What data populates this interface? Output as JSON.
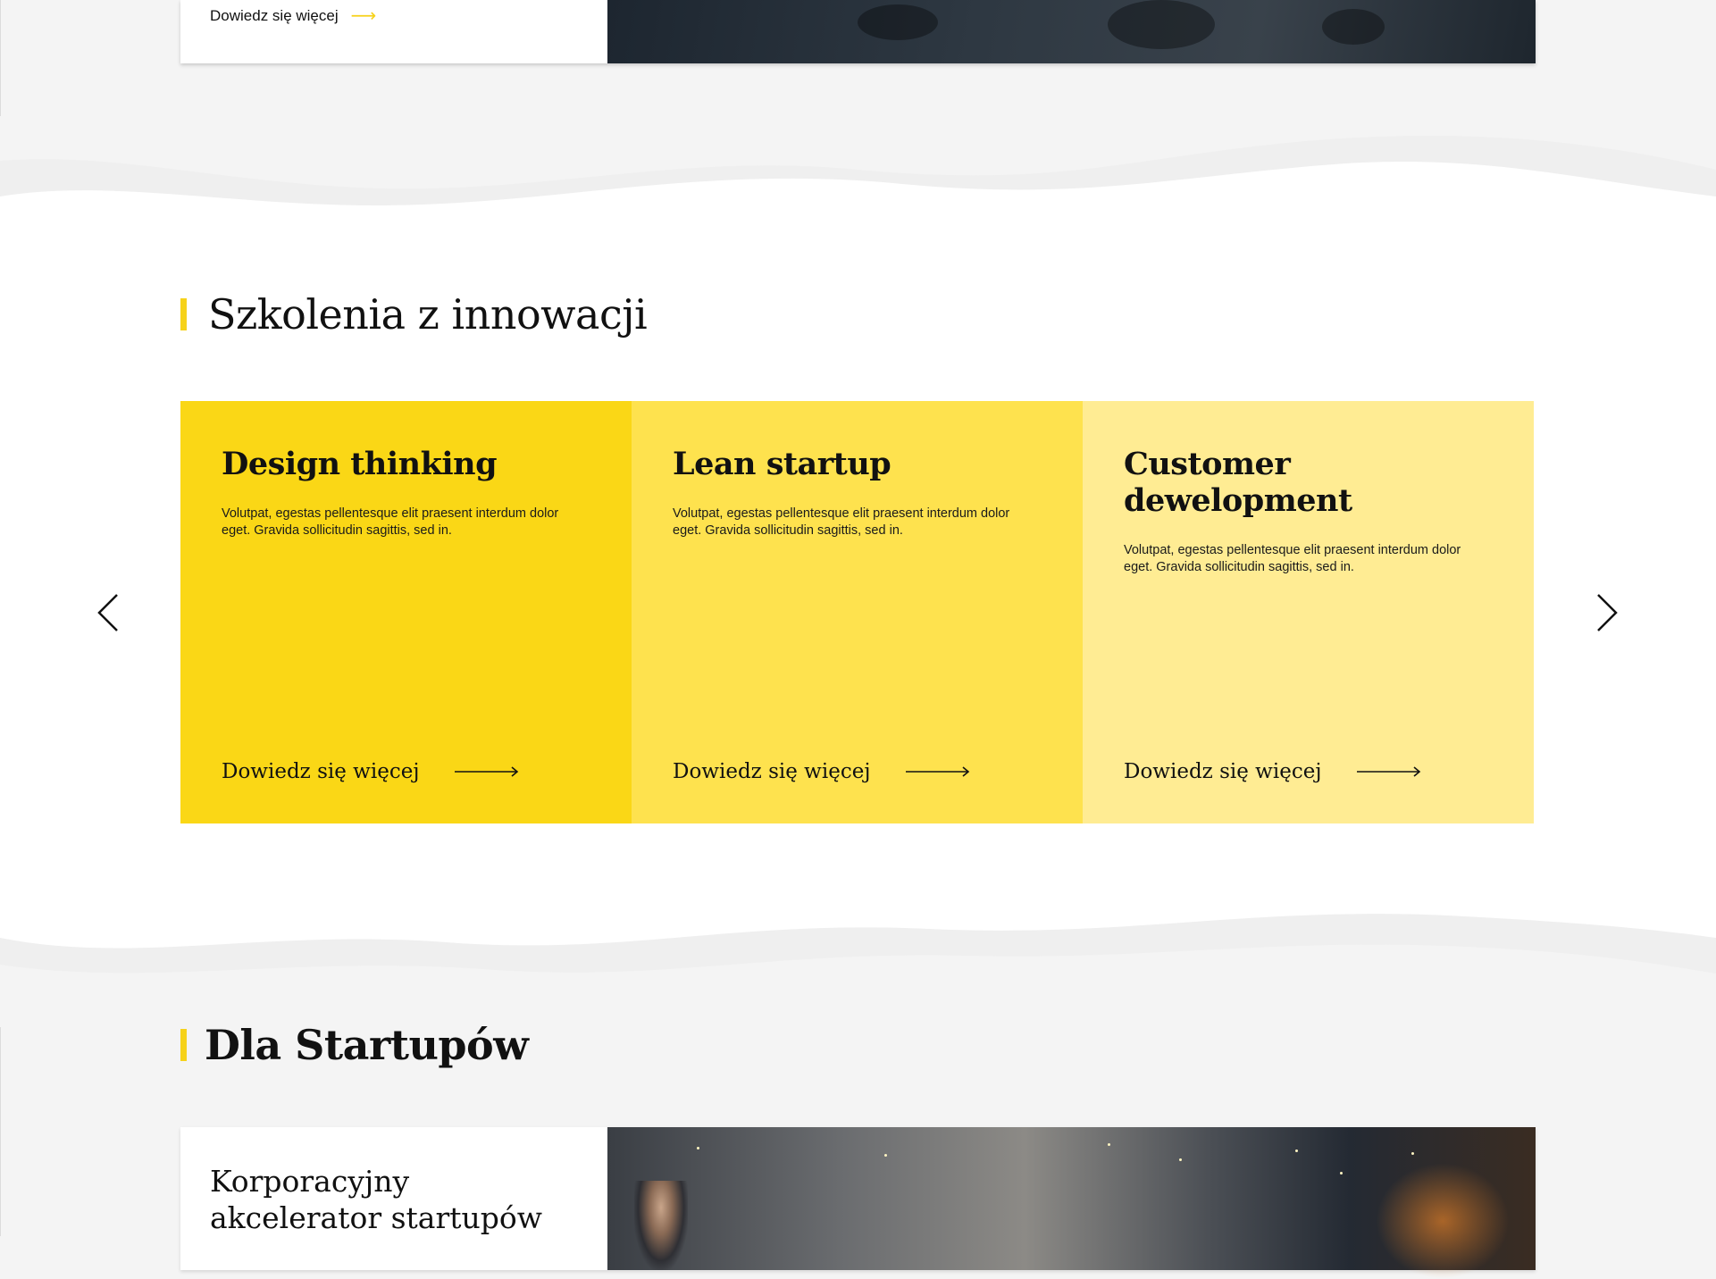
{
  "top_feature": {
    "more_label": "Dowiedz się więcej"
  },
  "trainings": {
    "title": "Szkolenia z innowacji",
    "cards": [
      {
        "title": "Design thinking",
        "description": "Volutpat, egestas pellentesque elit praesent interdum dolor eget. Gravida sollicitudin sagittis, sed in.",
        "more_label": "Dowiedz się więcej"
      },
      {
        "title": "Lean startup",
        "description": "Volutpat, egestas pellentesque elit praesent interdum dolor eget. Gravida sollicitudin sagittis, sed in.",
        "more_label": "Dowiedz się więcej"
      },
      {
        "title": "Customer dewelopment",
        "description": "Volutpat, egestas pellentesque elit praesent interdum dolor eget. Gravida sollicitudin sagittis, sed in.",
        "more_label": "Dowiedz się więcej"
      }
    ]
  },
  "startups": {
    "title": "Dla Startupów",
    "feature_title": "Korporacyjny akcelerator startupów"
  },
  "icons": {
    "prev": "chevron-left-icon",
    "next": "chevron-right-icon",
    "arrow": "arrow-right-icon"
  },
  "colors": {
    "accent": "#f6d21a",
    "card_1": "#fad716",
    "card_2": "#fee24e",
    "card_3": "#ffec93",
    "background": "#f4f4f4"
  }
}
